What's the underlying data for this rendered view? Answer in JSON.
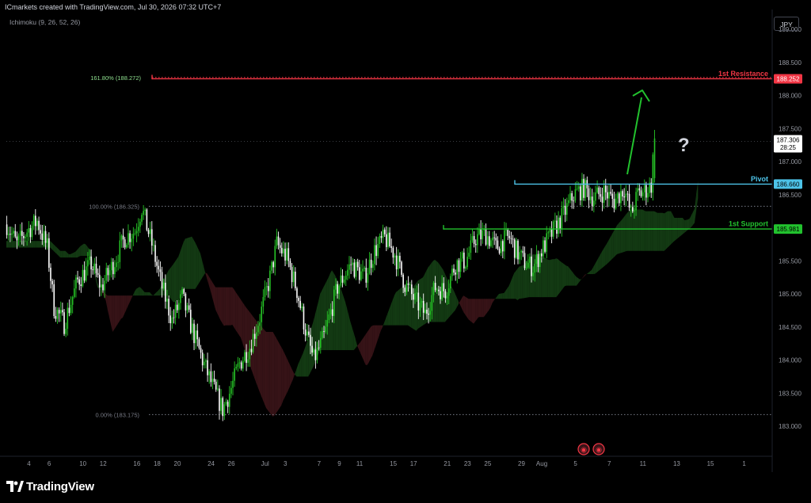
{
  "header": {
    "title": "ICmarkets created with TradingView.com, Jul 30, 2026 07:32 UTC+7",
    "indicator": "Ichimoku (9, 26, 52, 26)",
    "currency": "JPY"
  },
  "footer": {
    "brand": "TradingView"
  },
  "annotations": {
    "question_mark": "?",
    "event_badges": [
      "◉",
      "◉"
    ]
  },
  "colors": {
    "resistance": "#f23645",
    "pivot": "#4dc3e8",
    "support": "#22c22e",
    "fib": "#787b86",
    "bull": "#26c426",
    "bear": "#ffffff",
    "cloud_bull": "#143d14",
    "cloud_bear": "#3a1418"
  },
  "chart_data": {
    "type": "candlestick",
    "ylim": [
      182.9,
      189.15
    ],
    "y_ticks": [
      "189.000",
      "188.500",
      "188.000",
      "187.500",
      "187.000",
      "186.500",
      "186.000",
      "185.500",
      "185.000",
      "184.500",
      "184.000",
      "183.500",
      "183.000"
    ],
    "y_tick_values": [
      189.0,
      188.5,
      188.0,
      187.5,
      187.0,
      186.5,
      186.0,
      185.5,
      185.0,
      184.5,
      184.0,
      183.5,
      183.0
    ],
    "x_ticks": [
      "4",
      "6",
      "10",
      "12",
      "16",
      "18",
      "20",
      "24",
      "26",
      "Jul",
      "3",
      "7",
      "9",
      "11",
      "15",
      "17",
      "21",
      "23",
      "25",
      "29",
      "Aug",
      "5",
      "7",
      "11",
      "13",
      "15",
      "1"
    ],
    "x_tick_index": [
      4,
      16,
      36,
      48,
      68,
      80,
      92,
      112,
      124,
      144,
      156,
      176,
      188,
      200,
      220,
      232,
      252,
      264,
      276,
      296,
      308,
      328,
      348,
      368,
      388,
      408,
      428
    ],
    "x_index_range": [
      0,
      440
    ],
    "last_price": "187.306",
    "countdown": "28:25",
    "levels": [
      {
        "name": "1st Resistance",
        "value": 188.252,
        "label": "188.252",
        "role": "resistance"
      },
      {
        "name": "Pivot",
        "value": 186.66,
        "label": "186.660",
        "role": "pivot"
      },
      {
        "name": "1st Support",
        "value": 185.981,
        "label": "185.981",
        "role": "support"
      }
    ],
    "fib_levels": [
      {
        "label": "161.80% (188.272)",
        "value": 188.272
      },
      {
        "label": "100.00% (186.325)",
        "value": 186.325
      },
      {
        "label": "0.00% (183.175)",
        "value": 183.175
      }
    ],
    "anchors": [
      [
        0,
        186.05
      ],
      [
        6,
        185.75
      ],
      [
        12,
        185.95
      ],
      [
        18,
        186.1
      ],
      [
        24,
        185.7
      ],
      [
        28,
        184.8
      ],
      [
        34,
        184.55
      ],
      [
        42,
        185.2
      ],
      [
        50,
        185.45
      ],
      [
        56,
        185.1
      ],
      [
        64,
        185.5
      ],
      [
        70,
        185.85
      ],
      [
        76,
        185.95
      ],
      [
        80,
        186.3
      ],
      [
        86,
        185.75
      ],
      [
        92,
        185.1
      ],
      [
        98,
        184.6
      ],
      [
        104,
        184.95
      ],
      [
        110,
        184.45
      ],
      [
        116,
        184.0
      ],
      [
        122,
        183.6
      ],
      [
        128,
        183.25
      ],
      [
        132,
        183.5
      ],
      [
        138,
        183.95
      ],
      [
        144,
        184.2
      ],
      [
        150,
        184.65
      ],
      [
        156,
        185.25
      ],
      [
        160,
        185.75
      ],
      [
        166,
        185.55
      ],
      [
        172,
        185.05
      ],
      [
        178,
        184.35
      ],
      [
        182,
        184.0
      ],
      [
        188,
        184.35
      ],
      [
        196,
        185.1
      ],
      [
        204,
        185.45
      ],
      [
        212,
        185.25
      ],
      [
        218,
        185.65
      ],
      [
        224,
        185.85
      ],
      [
        230,
        185.6
      ],
      [
        236,
        185.15
      ],
      [
        242,
        184.9
      ],
      [
        248,
        184.7
      ],
      [
        254,
        185.1
      ],
      [
        260,
        185.05
      ],
      [
        266,
        185.45
      ],
      [
        272,
        185.5
      ],
      [
        278,
        185.85
      ],
      [
        284,
        185.9
      ],
      [
        290,
        185.7
      ],
      [
        294,
        185.8
      ],
      [
        298,
        185.85
      ],
      [
        302,
        185.65
      ],
      [
        306,
        185.5
      ],
      [
        312,
        185.4
      ],
      [
        318,
        185.7
      ],
      [
        324,
        185.95
      ],
      [
        330,
        186.2
      ],
      [
        336,
        186.5
      ],
      [
        342,
        186.6
      ],
      [
        348,
        186.45
      ],
      [
        354,
        186.55
      ],
      [
        360,
        186.4
      ],
      [
        366,
        186.6
      ],
      [
        370,
        186.2
      ],
      [
        374,
        186.5
      ],
      [
        378,
        186.55
      ],
      [
        382,
        186.65
      ],
      [
        384,
        187.4
      ]
    ]
  }
}
